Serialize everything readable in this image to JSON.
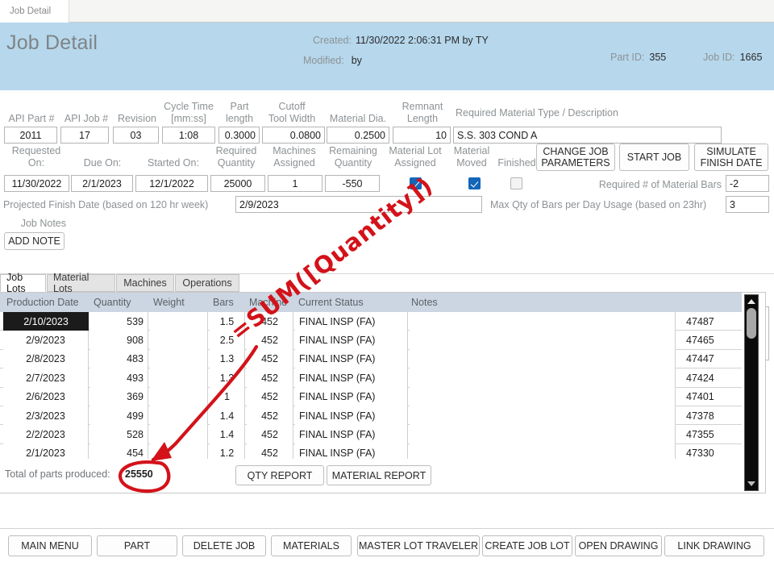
{
  "window": {
    "tab_label": "Job Detail"
  },
  "header": {
    "title": "Job Detail",
    "created_label": "Created:",
    "created_value": "11/30/2022 2:06:31 PM by TY",
    "modified_label": "Modified:",
    "modified_value": "by",
    "part_id_label": "Part ID:",
    "part_id_value": "355",
    "job_id_label": "Job ID:",
    "job_id_value": "1665"
  },
  "form": {
    "labels": {
      "api_part": "API Part #",
      "api_job": "API Job #",
      "revision": "Revision",
      "cycle_time": "Cycle Time\n[mm:ss]",
      "part_length": "Part\nlength",
      "cutoff_tool_width": "Cutoff\nTool Width",
      "material_dia": "Material Dia.",
      "remnant_length": "Remnant\nLength",
      "required_material_type": "Required Material Type / Description",
      "requested_on": "Requested\nOn:",
      "due_on": "Due On:",
      "started_on": "Started On:",
      "required_quantity": "Required\nQuantity",
      "machines_assigned": "Machines\nAssigned",
      "remaining_quantity": "Remaining\nQuantity",
      "material_lot_assigned": "Material Lot\nAssigned",
      "material_moved": "Material\nMoved",
      "finished": "Finished",
      "required_bars": "Required # of Material Bars",
      "projected_finish": "Projected Finish Date (based on 120 hr week)",
      "max_qty_bars": "Max Qty of Bars per Day Usage (based on 23hr)",
      "job_notes": "Job Notes"
    },
    "values": {
      "api_part": "2011",
      "api_job": "17",
      "revision": "03",
      "cycle_time": "1:08",
      "part_length": "0.3000",
      "cutoff_tool_width": "0.0800",
      "material_dia": "0.2500",
      "remnant_length": "10",
      "required_material_type": "S.S. 303 COND A",
      "requested_on": "11/30/2022",
      "due_on": "2/1/2023",
      "started_on": "12/1/2022",
      "required_quantity": "25000",
      "machines_assigned": "1",
      "remaining_quantity": "-550",
      "required_bars": "-2",
      "projected_finish": "2/9/2023",
      "max_qty_bars": "3",
      "job_notes": ""
    },
    "checkboxes": {
      "material_lot_assigned": true,
      "material_moved": true,
      "finished": false
    },
    "buttons": {
      "change_job_parameters": "CHANGE JOB PARAMETERS",
      "start_job": "START JOB",
      "simulate_finish_date": "SIMULATE FINISH DATE",
      "add_note": "ADD NOTE"
    }
  },
  "tabs": [
    {
      "label": "Job Lots",
      "active": true
    },
    {
      "label": "Material Lots",
      "active": false
    },
    {
      "label": "Machines",
      "active": false
    },
    {
      "label": "Operations",
      "active": false
    }
  ],
  "grid": {
    "columns": [
      "Production Date",
      "Quantity",
      "Weight",
      "Bars",
      "Machine",
      "Current Status",
      "Notes"
    ],
    "rows": [
      {
        "production_date": "2/10/2023",
        "quantity": "539",
        "weight": "",
        "bars": "1.5",
        "machine": "452",
        "current_status": "FINAL INSP (FA)",
        "notes": "",
        "id": "47487",
        "selected": true
      },
      {
        "production_date": "2/9/2023",
        "quantity": "908",
        "weight": "",
        "bars": "2.5",
        "machine": "452",
        "current_status": "FINAL INSP (FA)",
        "notes": "",
        "id": "47465",
        "selected": false
      },
      {
        "production_date": "2/8/2023",
        "quantity": "483",
        "weight": "",
        "bars": "1.3",
        "machine": "452",
        "current_status": "FINAL INSP (FA)",
        "notes": "",
        "id": "47447",
        "selected": false
      },
      {
        "production_date": "2/7/2023",
        "quantity": "493",
        "weight": "",
        "bars": "1.3",
        "machine": "452",
        "current_status": "FINAL INSP (FA)",
        "notes": "",
        "id": "47424",
        "selected": false
      },
      {
        "production_date": "2/6/2023",
        "quantity": "369",
        "weight": "",
        "bars": "1",
        "machine": "452",
        "current_status": "FINAL INSP (FA)",
        "notes": "",
        "id": "47401",
        "selected": false
      },
      {
        "production_date": "2/3/2023",
        "quantity": "499",
        "weight": "",
        "bars": "1.4",
        "machine": "452",
        "current_status": "FINAL INSP (FA)",
        "notes": "",
        "id": "47378",
        "selected": false
      },
      {
        "production_date": "2/2/2023",
        "quantity": "528",
        "weight": "",
        "bars": "1.4",
        "machine": "452",
        "current_status": "FINAL INSP (FA)",
        "notes": "",
        "id": "47355",
        "selected": false
      },
      {
        "production_date": "2/1/2023",
        "quantity": "454",
        "weight": "",
        "bars": "1.2",
        "machine": "452",
        "current_status": "FINAL INSP (FA)",
        "notes": "",
        "id": "47330",
        "selected": false
      }
    ],
    "total_label": "Total of parts produced:",
    "total_value": "25550",
    "qty_report_button": "QTY REPORT",
    "material_report_button": "MATERIAL REPORT"
  },
  "bottom_buttons": [
    "MAIN MENU",
    "PART",
    "DELETE JOB",
    "MATERIALS",
    "MASTER LOT TRAVELER",
    "CREATE JOB LOT",
    "OPEN DRAWING",
    "LINK DRAWING"
  ],
  "annotation": {
    "text": "=SUM([Quantity])",
    "color": "#d3121a"
  }
}
